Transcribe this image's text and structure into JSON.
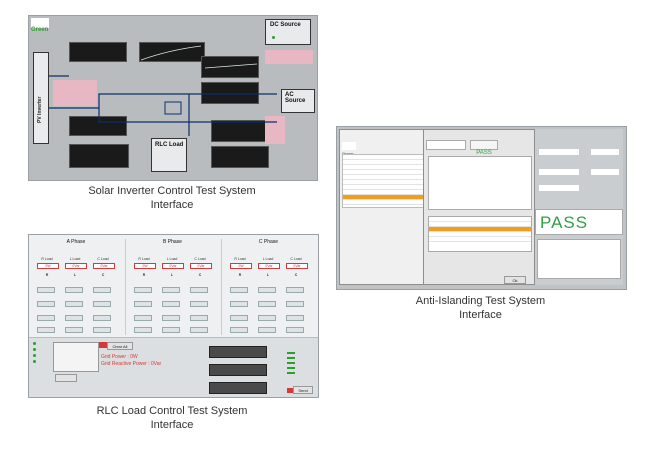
{
  "captions": {
    "solar": [
      "Solar Inverter Control Test System",
      "Interface"
    ],
    "anti": [
      "Anti-Islanding Test System",
      "Interface"
    ],
    "rlc": [
      "RLC Load Control Test System",
      "Interface"
    ]
  },
  "solar": {
    "logo": "Green",
    "pv_label": "PV Inverter",
    "dc_label": "DC Source",
    "ac_label": "AC Source",
    "rlc_label": "RLC Load"
  },
  "anti": {
    "logo": "Green",
    "pass_small": "PASS",
    "pass_big": "PASS",
    "ok_label": "Ok"
  },
  "rlc": {
    "phases": [
      {
        "title": "A Phase",
        "loads": [
          "R Load",
          "L Load",
          "C Load"
        ],
        "values": [
          "0W",
          "0Var",
          "0Var"
        ]
      },
      {
        "title": "B Phase",
        "loads": [
          "R Load",
          "L Load",
          "C Load"
        ],
        "values": [
          "0W",
          "0Var",
          "0Var"
        ]
      },
      {
        "title": "C Phase",
        "loads": [
          "R Load",
          "L Load",
          "C Load"
        ],
        "values": [
          "0W",
          "0Var",
          "0Var"
        ]
      }
    ],
    "columns": [
      "R",
      "L",
      "C"
    ],
    "grid_power": "Grid Power : 0W",
    "grid_reactive": "Grid Reactive Power : 0Var",
    "clear_all": "Clear All",
    "send": "Send"
  },
  "colors": {
    "accent_green": "#2e9e2e",
    "pass_green": "#2f9e44",
    "alert_red": "#d43a3a",
    "select_orange": "#f39c1f"
  }
}
